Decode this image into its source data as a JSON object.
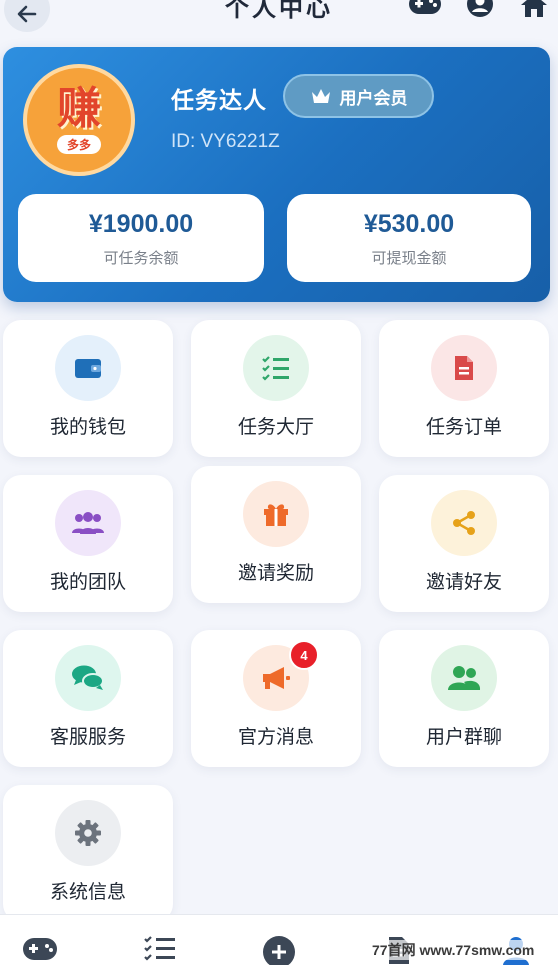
{
  "header": {
    "title": "个人中心",
    "icons": [
      "back-arrow-icon",
      "gamepad-icon",
      "user-icon",
      "home-icon"
    ]
  },
  "profile": {
    "avatar_text": "赚",
    "avatar_pill": "多多",
    "username": "任务达人",
    "member_badge": "用户会员",
    "user_id": "ID: VY6221Z",
    "task_balance": {
      "amount": "¥1900.00",
      "label": "可任务余额"
    },
    "withdraw_balance": {
      "amount": "¥530.00",
      "label": "可提现金额"
    }
  },
  "tiles": [
    {
      "label": "我的钱包",
      "icon": "wallet-icon",
      "color": "#1f6fb8",
      "bg": "#e4f0fb"
    },
    {
      "label": "任务大厅",
      "icon": "task-list-icon",
      "color": "#2fa66a",
      "bg": "#e3f5ea"
    },
    {
      "label": "任务订单",
      "icon": "order-document-icon",
      "color": "#d94a4a",
      "bg": "#fbe6e6"
    },
    {
      "label": "我的团队",
      "icon": "team-icon",
      "color": "#8a4fc4",
      "bg": "#f0e6fa"
    },
    {
      "label": "邀请奖励",
      "icon": "gift-icon",
      "color": "#ee6a2a",
      "bg": "#fdeadf"
    },
    {
      "label": "邀请好友",
      "icon": "share-icon",
      "color": "#e6a21a",
      "bg": "#fdf2da"
    },
    {
      "label": "客服服务",
      "icon": "chat-icon",
      "color": "#1ca784",
      "bg": "#def6ee"
    },
    {
      "label": "官方消息",
      "icon": "megaphone-icon",
      "color": "#ee6a2a",
      "bg": "#fdeadf",
      "badge": "4"
    },
    {
      "label": "用户群聊",
      "icon": "group-chat-icon",
      "color": "#2fa655",
      "bg": "#e0f4e5"
    },
    {
      "label": "系统信息",
      "icon": "gear-icon",
      "color": "#6c737d",
      "bg": "#eceef1"
    }
  ],
  "bottom_nav": {
    "items": [
      "gamepad-icon",
      "task-list-icon",
      "add-icon",
      "document-icon",
      "user-icon"
    ]
  },
  "watermark": "77首网  www.77smw.com"
}
